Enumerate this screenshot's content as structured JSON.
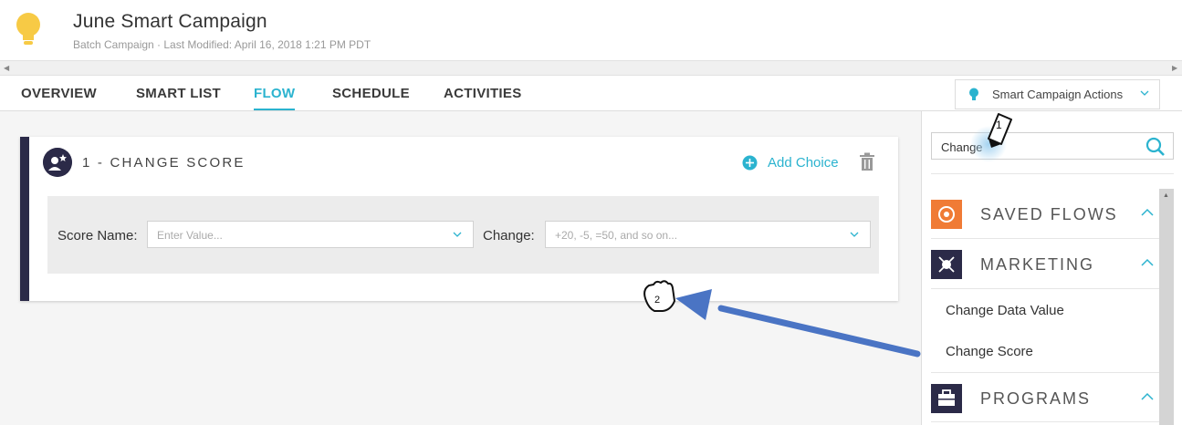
{
  "header": {
    "title": "June Smart Campaign",
    "subtitle": "Batch Campaign · Last Modified: April 16, 2018 1:21 PM PDT"
  },
  "tabs": [
    {
      "label": "OVERVIEW",
      "active": false
    },
    {
      "label": "SMART LIST",
      "active": false
    },
    {
      "label": "FLOW",
      "active": true
    },
    {
      "label": "SCHEDULE",
      "active": false
    },
    {
      "label": "ACTIVITIES",
      "active": false
    }
  ],
  "actions_button": {
    "label": "Smart Campaign Actions",
    "icon": "lightbulb-icon"
  },
  "flow_step": {
    "title": "1 - CHANGE SCORE",
    "add_choice_label": "Add Choice",
    "score_name_label": "Score Name:",
    "score_name_placeholder": "Enter Value...",
    "change_label": "Change:",
    "change_placeholder": "+20, -5, =50, and so on..."
  },
  "sidebar": {
    "search_value": "Change",
    "sections": [
      {
        "label": "SAVED FLOWS",
        "icon": "saved-flows-icon",
        "color": "#f07b35"
      },
      {
        "label": "MARKETING",
        "icon": "marketing-icon",
        "color": "#2b2a48"
      },
      {
        "label": "PROGRAMS",
        "icon": "briefcase-icon",
        "color": "#2b2a48"
      }
    ],
    "marketing_items": [
      "Change Data Value",
      "Change Score"
    ]
  },
  "annotations": {
    "badge_1": "1",
    "badge_2": "2",
    "arrow_color": "#4a74c4"
  },
  "colors": {
    "accent": "#2bb3cf",
    "navy": "#2b2a48",
    "bulb": "#f7ca45",
    "orange": "#f07b35"
  }
}
